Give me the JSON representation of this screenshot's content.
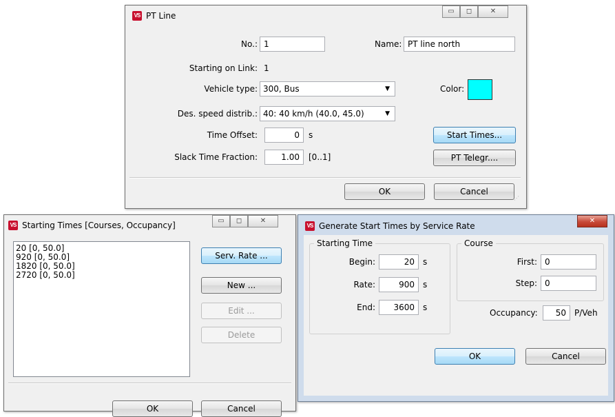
{
  "pt_line": {
    "title": "PT Line",
    "no_label": "No.:",
    "no_value": "1",
    "name_label": "Name:",
    "name_value": "PT line north",
    "starting_on_link_label": "Starting on Link:",
    "starting_on_link_value": "1",
    "vehicle_type_label": "Vehicle type:",
    "vehicle_type_value": "300, Bus",
    "color_label": "Color:",
    "color_value": "#00ffff",
    "des_speed_label": "Des. speed distrib.:",
    "des_speed_value": "40: 40 km/h (40.0, 45.0)",
    "time_offset_label": "Time Offset:",
    "time_offset_value": "0",
    "time_offset_unit": "s",
    "slack_label": "Slack Time Fraction:",
    "slack_value": "1.00",
    "slack_range": "[0..1]",
    "start_times_button": "Start Times...",
    "pt_telegr_button": "PT Telegr....",
    "ok_button": "OK",
    "cancel_button": "Cancel"
  },
  "starting_times": {
    "title": "Starting Times [Courses, Occupancy]",
    "items": [
      "20 [0, 50.0]",
      "920 [0, 50.0]",
      "1820 [0, 50.0]",
      "2720 [0, 50.0]"
    ],
    "serv_rate_button": "Serv. Rate ...",
    "new_button": "New ...",
    "edit_button": "Edit ...",
    "delete_button": "Delete",
    "ok_button": "OK",
    "cancel_button": "Cancel"
  },
  "generate": {
    "title": "Generate Start Times by Service Rate",
    "starting_time_group": "Starting Time",
    "begin_label": "Begin:",
    "begin_value": "20",
    "begin_unit": "s",
    "rate_label": "Rate:",
    "rate_value": "900",
    "rate_unit": "s",
    "end_label": "End:",
    "end_value": "3600",
    "end_unit": "s",
    "course_group": "Course",
    "first_label": "First:",
    "first_value": "0",
    "step_label": "Step:",
    "step_value": "0",
    "occupancy_label": "Occupancy:",
    "occupancy_value": "50",
    "occupancy_unit": "P/Veh",
    "ok_button": "OK",
    "cancel_button": "Cancel"
  }
}
